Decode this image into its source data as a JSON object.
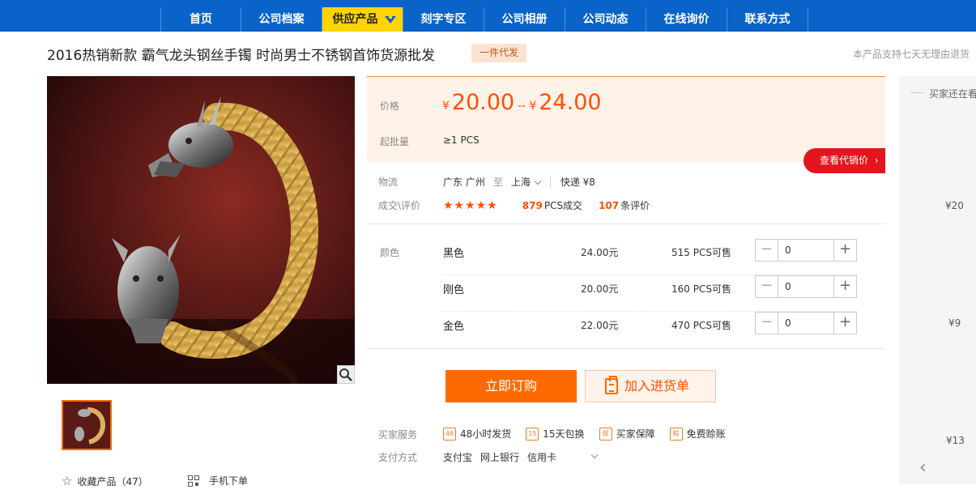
{
  "nav": {
    "items": [
      {
        "label": "首页"
      },
      {
        "label": "公司档案"
      },
      {
        "label": "供应产品"
      },
      {
        "label": "刻字专区"
      },
      {
        "label": "公司相册"
      },
      {
        "label": "公司动态"
      },
      {
        "label": "在线询价"
      },
      {
        "label": "联系方式"
      }
    ]
  },
  "product": {
    "title": "2016热销新款 霸气龙头钢丝手镯 时尚男士不锈钢首饰货源批发",
    "tag": "一件代发",
    "return_note": "本产品支持七天无理由退货"
  },
  "price": {
    "label": "价格",
    "currency": "¥",
    "min": "20.00",
    "separator": "--",
    "max": "24.00",
    "moq_label": "起批量",
    "moq_value": "≥1  PCS",
    "agent_button": "查看代销价"
  },
  "logistics": {
    "label": "物流",
    "from": "广东 广州",
    "to_word": "至",
    "to": "上海",
    "express": "快递 ¥8"
  },
  "deal": {
    "label": "成交\\评价",
    "stars": "★★★★★",
    "sold_count": "879",
    "sold_suffix": "PCS成交",
    "review_count": "107",
    "review_suffix": "条评价"
  },
  "sku": {
    "label": "颜色",
    "rows": [
      {
        "name": "黑色",
        "price": "24.00元",
        "stock": "515 PCS可售",
        "qty": "0"
      },
      {
        "name": "刚色",
        "price": "20.00元",
        "stock": "160 PCS可售",
        "qty": "0"
      },
      {
        "name": "金色",
        "price": "22.00元",
        "stock": "470 PCS可售",
        "qty": "0"
      }
    ]
  },
  "actions": {
    "order": "立即订购",
    "cart": "加入进货单",
    "favorite": "收藏产品（47）",
    "mobile": "手机下单"
  },
  "services": {
    "label": "买家服务",
    "items": [
      {
        "icon_text": "48",
        "label": "48小时发货"
      },
      {
        "icon_text": "15",
        "label": "15天包换"
      },
      {
        "icon_text": "保",
        "label": "买家保障"
      },
      {
        "icon_text": "赊",
        "label": "免费赊账"
      }
    ]
  },
  "payment": {
    "label": "支付方式",
    "methods": [
      "支付宝",
      "网上银行",
      "信用卡"
    ]
  },
  "sidebar": {
    "title": "买家还在看",
    "prices": [
      "¥20",
      "¥9",
      "¥13"
    ]
  },
  "colors": {
    "nav_bg": "#0a63c8",
    "nav_active": "#ffd400",
    "accent": "#ff5000",
    "order_button": "#ff6a00",
    "agent_button": "#e4151f"
  }
}
